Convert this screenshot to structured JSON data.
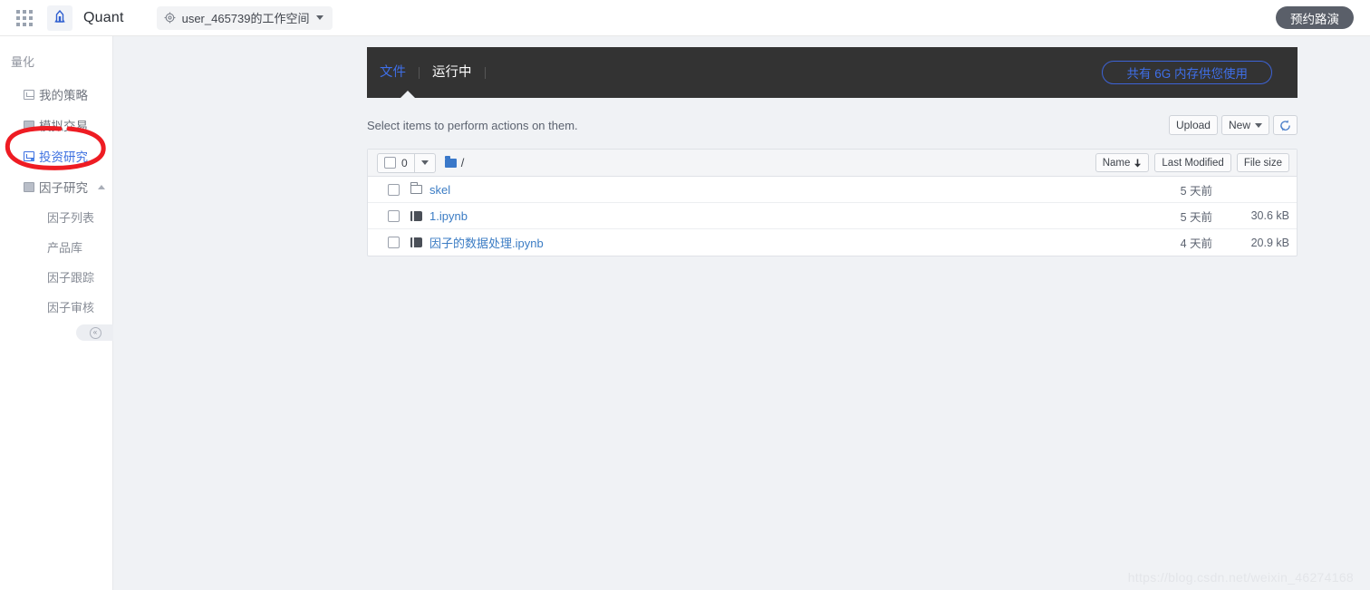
{
  "topbar": {
    "apps_icon": "grid-apps-icon",
    "logo_icon": "rocket-logo-icon",
    "brand": "Quant",
    "workspace": {
      "gear_icon": "gear-icon",
      "label": "user_465739的工作空间",
      "caret": "chevron-down-icon"
    },
    "roadshow_button": "预约路演"
  },
  "sidebar": {
    "title": "量化",
    "items": [
      {
        "label": "我的策略",
        "icon": "chart-square-icon",
        "selected": false
      },
      {
        "label": "模拟交易",
        "icon": "list-square-icon",
        "selected": false
      },
      {
        "label": "投资研究",
        "icon": "research-square-icon",
        "selected": true
      },
      {
        "label": "因子研究",
        "icon": "grid-square-icon",
        "selected": false,
        "expanded": true
      }
    ],
    "subitems": [
      "因子列表",
      "产品库",
      "因子跟踪",
      "因子审核"
    ],
    "collapse_icon": "«"
  },
  "annotation": {
    "type": "red-ellipse",
    "color": "#ee1c23",
    "target": "投资研究"
  },
  "notebook": {
    "tabs": [
      {
        "label": "文件",
        "active": true
      },
      {
        "label": "运行中",
        "active": false
      }
    ],
    "memory_badge": "共有 6G 内存供您使用",
    "memory_badge_color": "#3f6fe8",
    "hint": "Select items to perform actions on them.",
    "buttons": {
      "upload": "Upload",
      "new": "New",
      "new_caret": "chevron-down-icon",
      "refresh_icon": "refresh-icon"
    },
    "selection_count": "0",
    "breadcrumb": "/",
    "breadcrumb_icon": "folder-icon",
    "columns": [
      {
        "label": "Name",
        "sort_icon": "arrow-down-icon"
      },
      {
        "label": "Last Modified",
        "sort_icon": ""
      },
      {
        "label": "File size",
        "sort_icon": ""
      }
    ],
    "rows": [
      {
        "icon": "folder-icon",
        "name": "skel",
        "ext": "",
        "modified": "5 天前",
        "size": ""
      },
      {
        "icon": "notebook-icon",
        "name": "1",
        "ext": ".ipynb",
        "modified": "5 天前",
        "size": "30.6 kB"
      },
      {
        "icon": "notebook-icon",
        "name": "因子的数据处理",
        "ext": ".ipynb",
        "modified": "4 天前",
        "size": "20.9 kB"
      }
    ]
  },
  "watermark": "https://blog.csdn.net/weixin_46274168"
}
